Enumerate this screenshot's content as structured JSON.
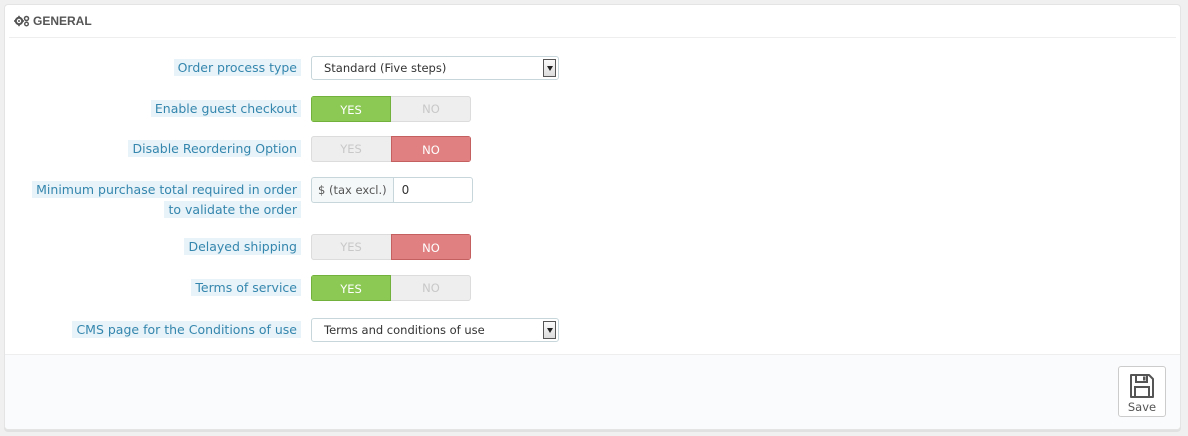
{
  "panel": {
    "title": "GENERAL",
    "title_icon": "cogs-icon"
  },
  "fields": {
    "order_process_type": {
      "label": "Order process type",
      "value": "Standard (Five steps)"
    },
    "guest_checkout": {
      "label": "Enable guest checkout",
      "yes": "YES",
      "no": "NO",
      "selected": "YES"
    },
    "disable_reordering": {
      "label": "Disable Reordering Option",
      "yes": "YES",
      "no": "NO",
      "selected": "NO"
    },
    "minimum_purchase": {
      "label_line1": "Minimum purchase total required in order",
      "label_line2": "to validate the order",
      "addon": "$ (tax excl.)",
      "value": "0"
    },
    "delayed_shipping": {
      "label": "Delayed shipping",
      "yes": "YES",
      "no": "NO",
      "selected": "NO"
    },
    "terms_of_service": {
      "label": "Terms of service",
      "yes": "YES",
      "no": "NO",
      "selected": "YES"
    },
    "cms_page_conditions": {
      "label": "CMS page for the Conditions of use",
      "value": "Terms and conditions of use"
    }
  },
  "footer": {
    "save_label": "Save",
    "save_icon": "floppy-disk-icon"
  },
  "colors": {
    "label_text": "#3586ae",
    "label_highlight": "#e7f3f8",
    "yes_active": "#8bc954",
    "no_active": "#e08080",
    "toggle_inactive": "#eeeeee"
  }
}
